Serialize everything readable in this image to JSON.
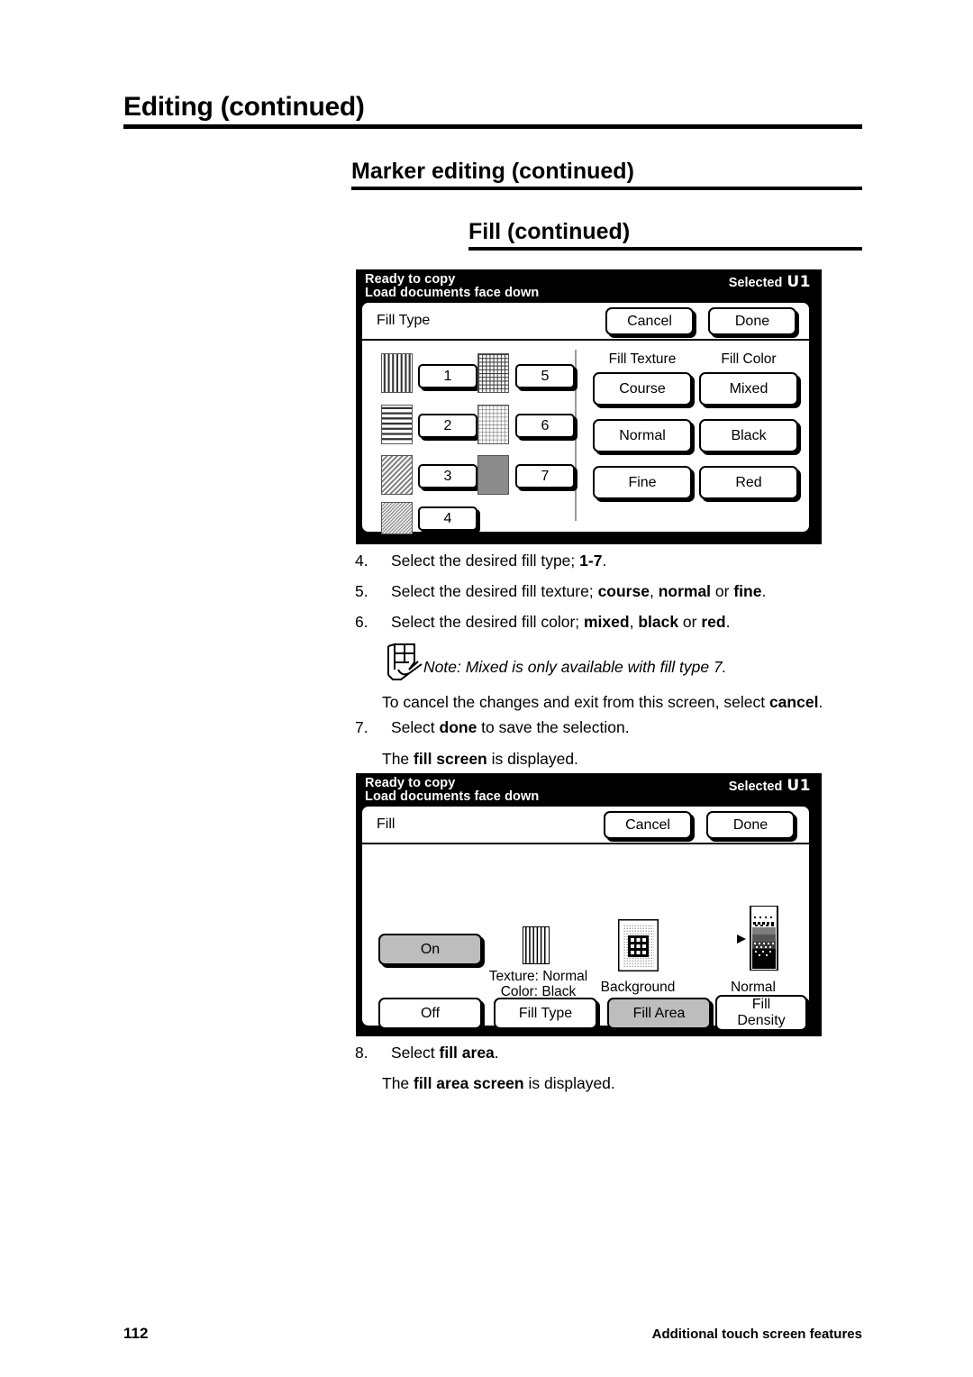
{
  "headings": {
    "h1": "Editing (continued)",
    "h2": "Marker editing (continued)",
    "h3": "Fill (continued)"
  },
  "screen1": {
    "status": {
      "line1": "Ready to copy",
      "line2": "Load documents face down",
      "selected_label": "Selected",
      "selected_value": "U1"
    },
    "title": "Fill Type",
    "cancel": "Cancel",
    "done": "Done",
    "fill_types": [
      {
        "number": "1",
        "pattern": "vertical-lines"
      },
      {
        "number": "2",
        "pattern": "horizontal-lines"
      },
      {
        "number": "3",
        "pattern": "diagonal-hatch-coarse"
      },
      {
        "number": "4",
        "pattern": "diagonal-hatch-fine"
      },
      {
        "number": "5",
        "pattern": "crosshatch-dense"
      },
      {
        "number": "6",
        "pattern": "crosshatch-light"
      },
      {
        "number": "7",
        "pattern": "solid-gray"
      }
    ],
    "texture_header": "Fill Texture",
    "color_header": "Fill Color",
    "texture_options": [
      "Course",
      "Normal",
      "Fine"
    ],
    "color_options": [
      "Mixed",
      "Black",
      "Red"
    ]
  },
  "instructions": [
    {
      "num": "4.",
      "html": "Select the desired fill type; <b>1-7</b>."
    },
    {
      "num": "5.",
      "html": "Select the desired fill texture; <b>course</b>, <b>normal</b> or <b>fine</b>."
    },
    {
      "num": "6.",
      "html": "Select the desired fill color; <b>mixed</b>, <b>black</b> or <b>red</b>."
    }
  ],
  "note": "Note: Mixed is only available with fill type 7.",
  "cancel_sentence": "To cancel the changes and exit from this screen, select <b>cancel</b>.",
  "instructions2": [
    {
      "num": "7.",
      "html": "Select <b>done</b> to save the selection."
    }
  ],
  "fill_screen_sentence": "The <b>fill screen</b> is displayed.",
  "screen2": {
    "status": {
      "line1": "Ready to copy",
      "line2": "Load documents face down",
      "selected_label": "Selected",
      "selected_value": "U1"
    },
    "title": "Fill",
    "cancel": "Cancel",
    "done": "Done",
    "on_label": "On",
    "off_label": "Off",
    "texture_value": "Texture: Normal",
    "color_value": "Color: Black",
    "fill_type_label": "Fill Type",
    "background_label": "Background",
    "fill_area_label": "Fill Area",
    "density_value": "Normal",
    "fill_density_label_line1": "Fill",
    "fill_density_label_line2": "Density"
  },
  "instructions3": [
    {
      "num": "8.",
      "html": "Select <b>fill area</b>."
    }
  ],
  "fill_area_sentence": "The <b>fill area screen</b> is displayed.",
  "footer": {
    "page_number": "112",
    "section": "Additional touch screen features"
  },
  "colors": {
    "selected_button": "#bdbdbd",
    "screen_background": "#000000",
    "panel_background": "#ffffff"
  }
}
